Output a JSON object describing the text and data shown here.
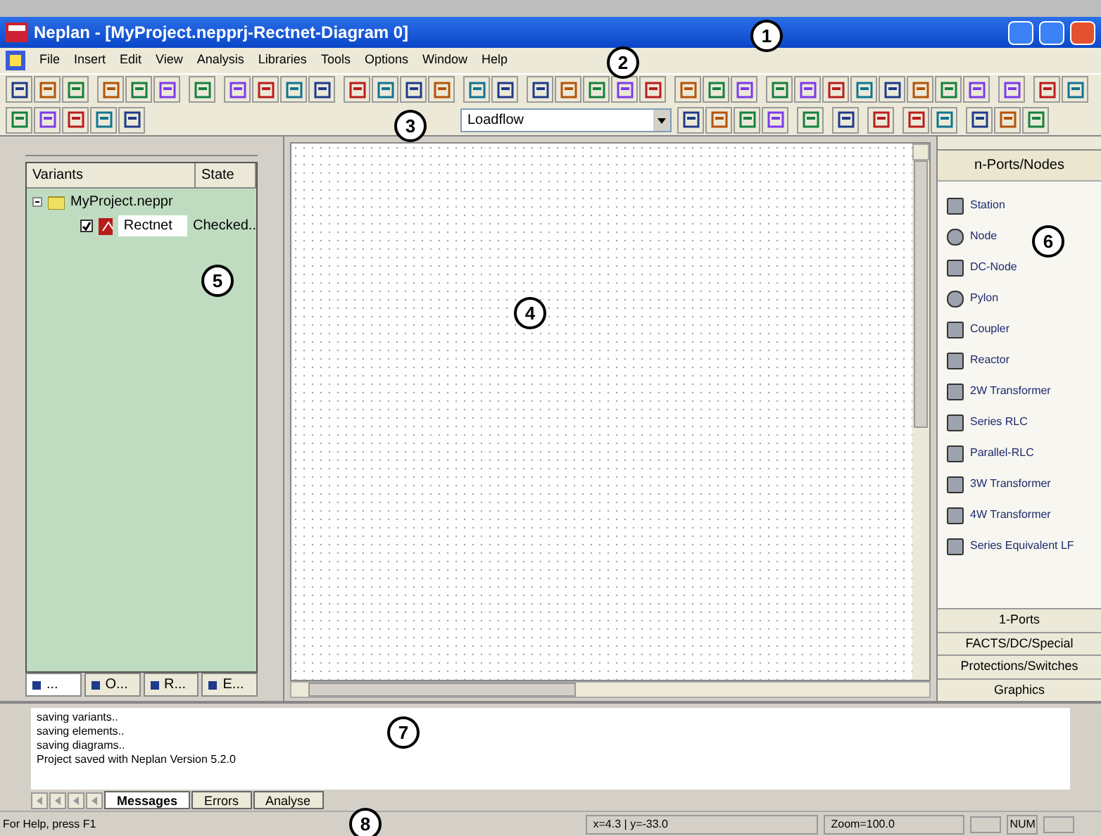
{
  "window": {
    "title": "Neplan - [MyProject.nepprj-Rectnet-Diagram 0]"
  },
  "menu": [
    "File",
    "Insert",
    "Edit",
    "View",
    "Analysis",
    "Libraries",
    "Tools",
    "Options",
    "Window",
    "Help"
  ],
  "toolbar": {
    "analysis_select": "Loadflow"
  },
  "variants_panel": {
    "columns": [
      "Variants",
      "State"
    ],
    "tree": [
      {
        "label": "MyProject.neppr",
        "expanded": true,
        "children": [
          {
            "label": "Rectnet",
            "checked": true,
            "selected": true,
            "state": "Checked.."
          }
        ]
      }
    ],
    "tabs": [
      {
        "label": "...",
        "selected": true
      },
      {
        "label": "O...",
        "selected": false
      },
      {
        "label": "R...",
        "selected": false
      },
      {
        "label": "E...",
        "selected": false
      }
    ]
  },
  "palette": {
    "header": "n-Ports/Nodes",
    "items": [
      "Station",
      "Node",
      "DC-Node",
      "Pylon",
      "Coupler",
      "Reactor",
      "2W Transformer",
      "Series RLC",
      "Parallel-RLC",
      "3W Transformer",
      "4W Transformer",
      "Series Equivalent LF"
    ],
    "sections": [
      "1-Ports",
      "FACTS/DC/Special",
      "Protections/Switches",
      "Graphics"
    ]
  },
  "messages": {
    "lines": [
      "saving variants..",
      "saving elements..",
      "saving diagrams..",
      "Project saved with Neplan Version 5.2.0"
    ],
    "tabs": [
      {
        "label": "Messages",
        "selected": true
      },
      {
        "label": "Errors",
        "selected": false
      },
      {
        "label": "Analyse",
        "selected": false
      }
    ]
  },
  "status_bar": {
    "help": "For Help, press F1",
    "coordinates": "x=4.3 | y=-33.0",
    "zoom": "Zoom=100.0",
    "num": "NUM"
  },
  "callouts": [
    "1",
    "2",
    "3",
    "4",
    "5",
    "6",
    "7",
    "8"
  ]
}
